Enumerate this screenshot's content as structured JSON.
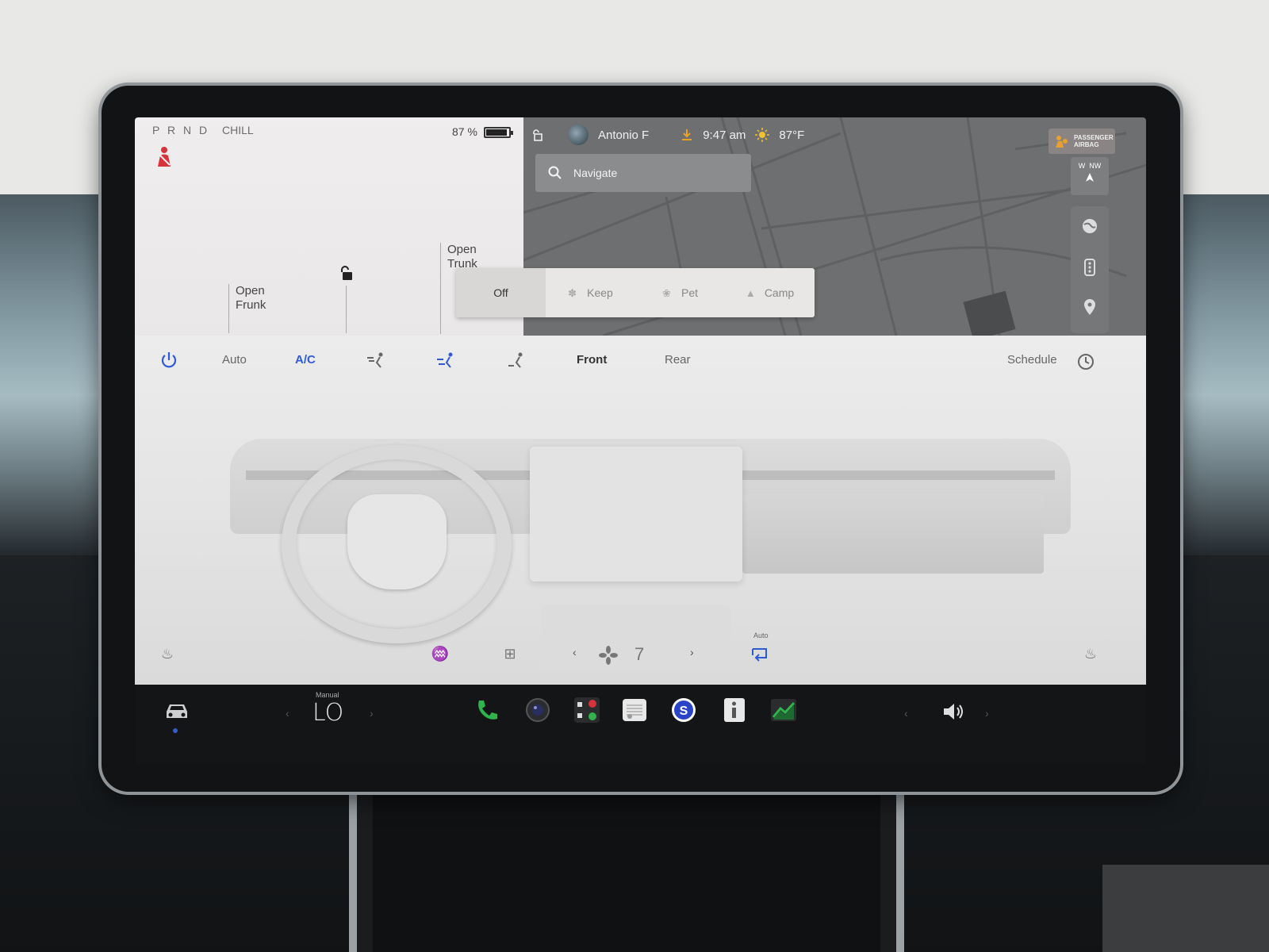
{
  "status": {
    "gears": "P R N D",
    "drive_mode": "CHILL",
    "battery_percent_text": "87 %",
    "battery_level": 0.87,
    "user_name": "Antonio F",
    "time": "9:47 am",
    "temperature_outside": "87°F",
    "airbag_line1": "PASSENGER",
    "airbag_line2": "AIRBAG"
  },
  "car_panel": {
    "open_frunk_line1": "Open",
    "open_frunk_line2": "Frunk",
    "open_trunk_line1": "Open",
    "open_trunk_line2": "Trunk"
  },
  "map": {
    "search_placeholder": "Navigate",
    "compass_w": "W",
    "compass_nw": "NW"
  },
  "climate_keeper": {
    "options": [
      {
        "label": "Off",
        "active": true
      },
      {
        "label": "Keep",
        "active": false
      },
      {
        "label": "Pet",
        "active": false
      },
      {
        "label": "Camp",
        "active": false
      }
    ]
  },
  "climate": {
    "auto_label": "Auto",
    "ac_label": "A/C",
    "front_label": "Front",
    "rear_label": "Rear",
    "schedule_label": "Schedule",
    "fan_speed": "7",
    "recirc_auto_label": "Auto"
  },
  "dock": {
    "temp_mode_label": "Manual",
    "temp_value": "LO"
  },
  "colors": {
    "accent_blue": "#2e5bd4",
    "alert_red": "#d8323a",
    "phone_green": "#2fb34a"
  }
}
